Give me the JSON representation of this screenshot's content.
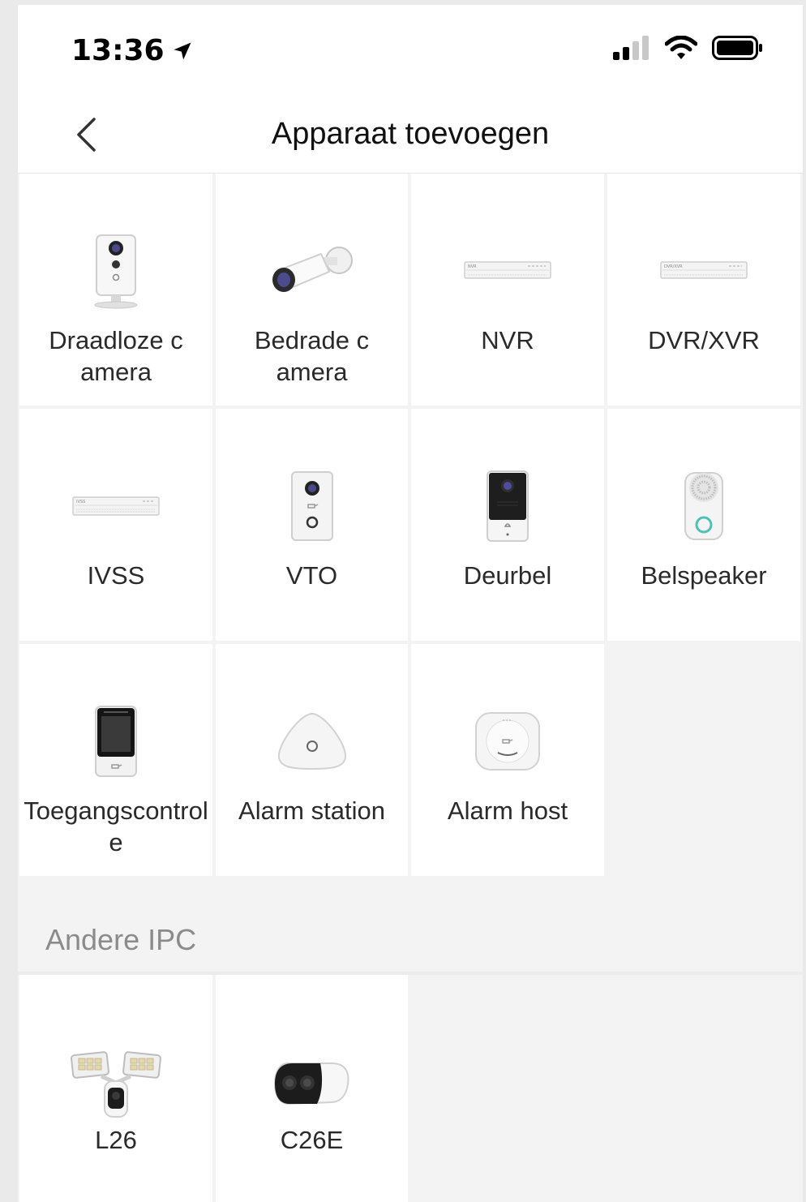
{
  "status_bar": {
    "time": "13:36",
    "location_icon": "location-arrow-icon",
    "signal_icon": "cellular-signal-icon",
    "wifi_icon": "wifi-icon",
    "battery_icon": "battery-icon"
  },
  "nav": {
    "title": "Apparaat toevoegen",
    "back_icon": "chevron-left-icon"
  },
  "devices": [
    {
      "label": "Draadloze camera",
      "icon": "wireless-camera-icon"
    },
    {
      "label": "Bedrade camera",
      "icon": "bullet-camera-icon"
    },
    {
      "label": "NVR",
      "icon": "nvr-recorder-icon"
    },
    {
      "label": "DVR/XVR",
      "icon": "dvr-recorder-icon"
    },
    {
      "label": "IVSS",
      "icon": "ivss-recorder-icon"
    },
    {
      "label": "VTO",
      "icon": "vto-intercom-icon"
    },
    {
      "label": "Deurbel",
      "icon": "doorbell-icon"
    },
    {
      "label": "Belspeaker",
      "icon": "chime-speaker-icon"
    },
    {
      "label": "Toegangscontrole",
      "icon": "access-control-icon"
    },
    {
      "label": "Alarm station",
      "icon": "alarm-station-icon"
    },
    {
      "label": "Alarm host",
      "icon": "alarm-host-icon"
    }
  ],
  "other_section": {
    "title": "Andere IPC",
    "items": [
      {
        "label": "L26",
        "icon": "floodlight-camera-icon"
      },
      {
        "label": "C26E",
        "icon": "compact-camera-icon"
      }
    ]
  },
  "colors": {
    "background": "#f3f3f3",
    "tile": "#ffffff",
    "text": "#2a2a2a",
    "section_text": "#8b8b8b",
    "accent_teal": "#4fc1b8"
  }
}
